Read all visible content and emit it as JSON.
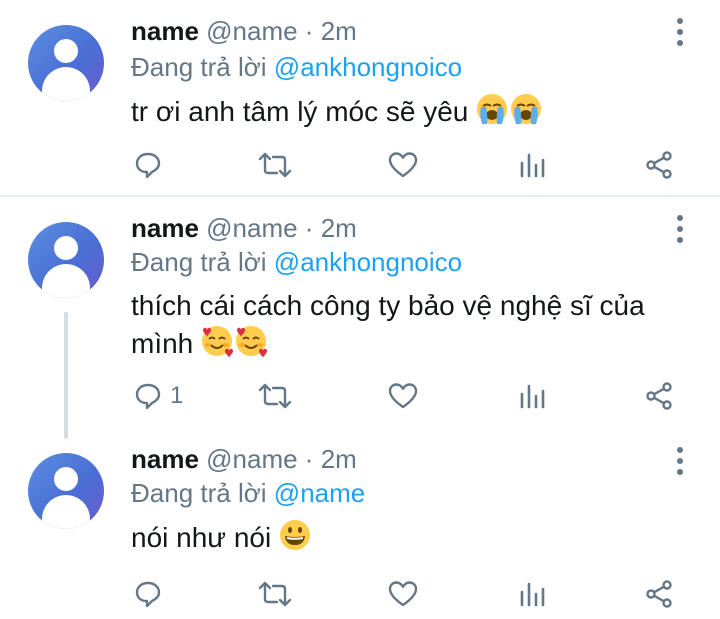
{
  "colors": {
    "accent": "#1da1f2",
    "muted": "#657786",
    "text": "#14171a",
    "divider": "#e6ecf0"
  },
  "tweets": [
    {
      "display_name": "name",
      "meta": "@name · 2m",
      "reply_prefix": "Đang trả lời",
      "reply_to": "@ankhongnoico",
      "text": "tr ơi anh tâm lý móc sẽ yêu",
      "emoji": "loudly-crying-face ×2",
      "reply_count": ""
    },
    {
      "display_name": "name",
      "meta": "@name · 2m",
      "reply_prefix": "Đang trả lời",
      "reply_to": "@ankhongnoico",
      "text_line1": "thích cái cách công ty bảo vệ nghệ sĩ của",
      "text_line2": "mình",
      "emoji": "smiling-face-with-hearts ×2",
      "reply_count": "1"
    },
    {
      "display_name": "name",
      "meta": "@name · 2m",
      "reply_prefix": "Đang trả lời",
      "reply_to": "@name",
      "text": "nói như nói",
      "emoji": "grinning-face",
      "reply_count": ""
    }
  ]
}
